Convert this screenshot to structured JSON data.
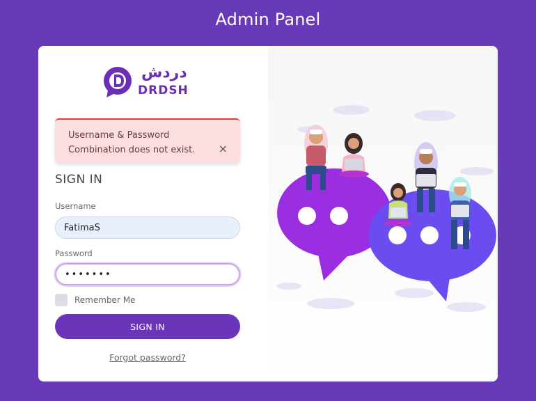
{
  "page": {
    "title": "Admin Panel"
  },
  "logo": {
    "latin": "DRDSH",
    "arabic": "دردش"
  },
  "alert": {
    "message": "Username & Password Combination does not exist.",
    "close_glyph": "×"
  },
  "form": {
    "heading": "SIGN IN",
    "username": {
      "label": "Username",
      "value": "FatimaS"
    },
    "password": {
      "label": "Password",
      "value": "•••••••"
    },
    "remember_label": "Remember Me",
    "remember_checked": false,
    "submit_label": "SIGN IN",
    "forgot_label": "Forgot password?"
  },
  "colors": {
    "background": "#673ab7",
    "accent": "#6a35b8",
    "alert_bg": "#fddede",
    "alert_border": "#e53935",
    "bubble_purple": "#9b2ee0",
    "bubble_blue": "#6b4cf0"
  },
  "icons": [
    "logo-d-bubble-icon",
    "close-icon",
    "chat-illustration"
  ]
}
